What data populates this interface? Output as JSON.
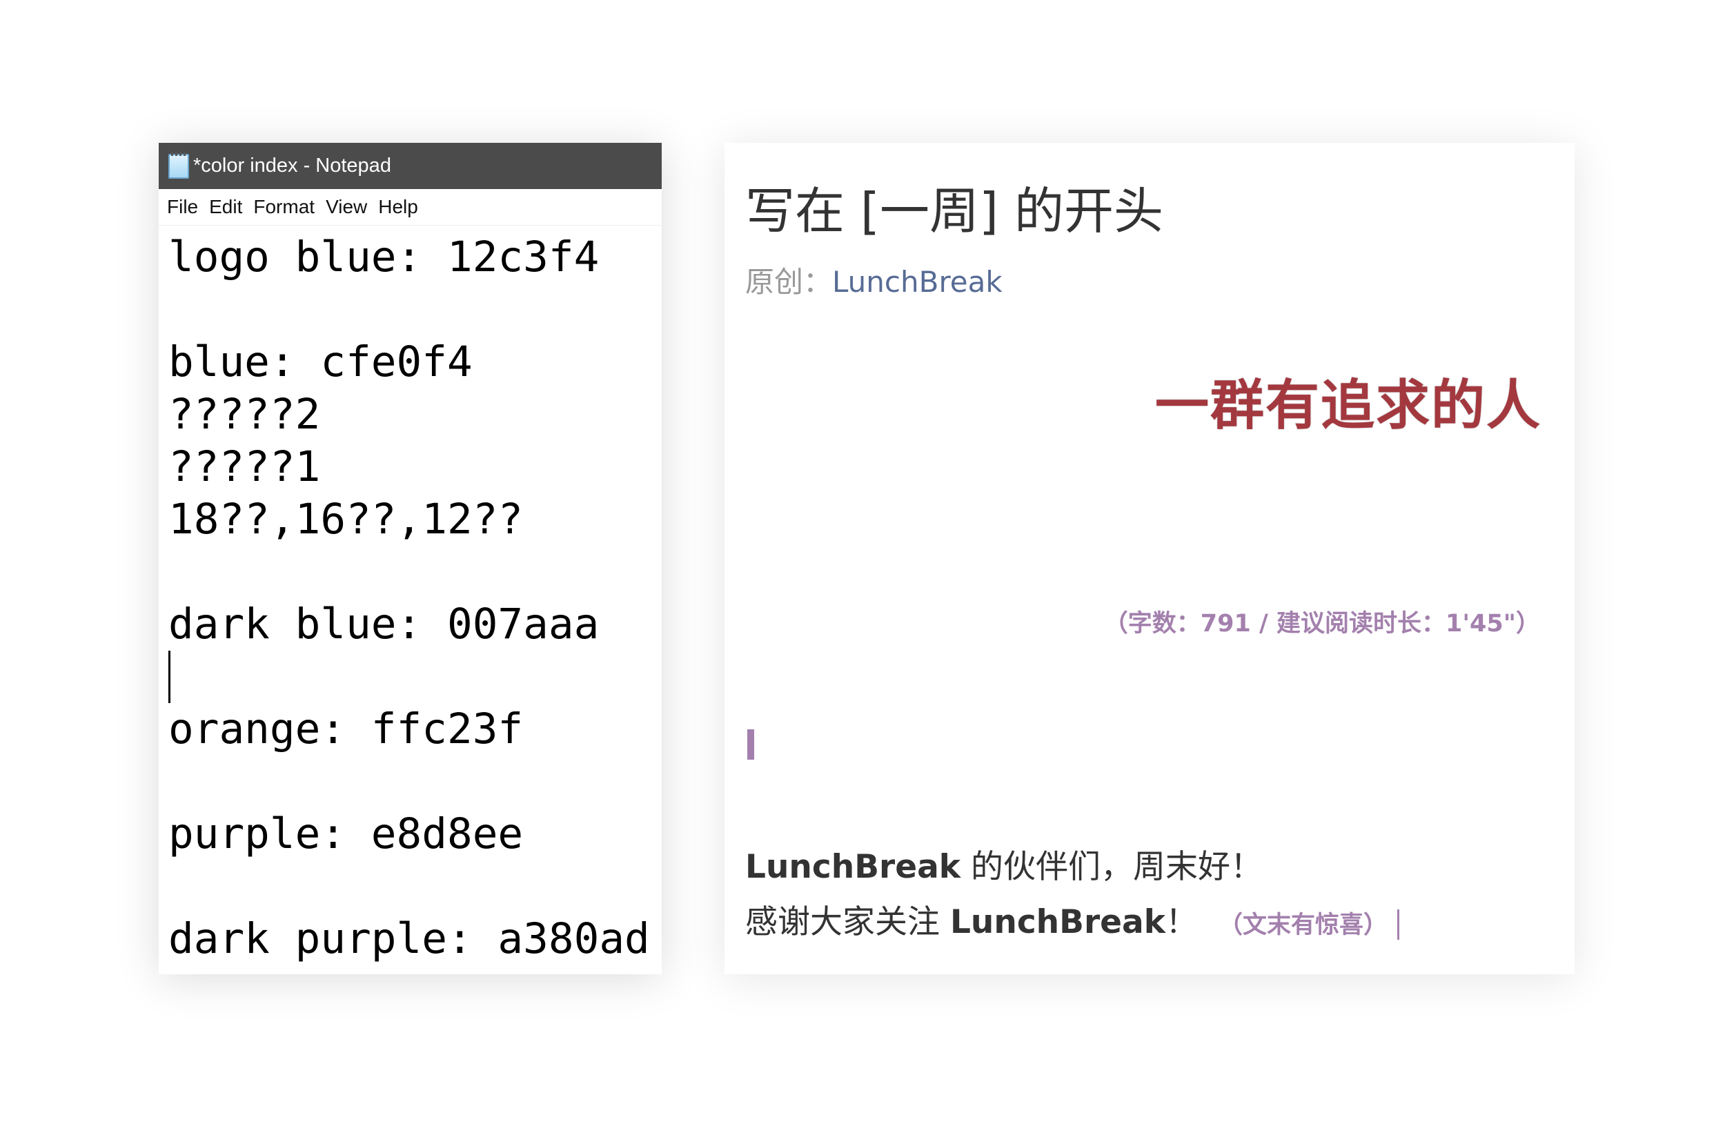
{
  "notepad": {
    "window_title": "*color index - Notepad",
    "menu": [
      "File",
      "Edit",
      "Format",
      "View",
      "Help"
    ],
    "lines": [
      "logo blue: 12c3f4",
      "",
      "blue: cfe0f4",
      "?????2",
      "?????1",
      "18??,16??,12??",
      "",
      "dark blue: 007aaa",
      "",
      "orange: ffc23f",
      "",
      "purple: e8d8ee",
      "",
      "dark purple: a380ad"
    ]
  },
  "article": {
    "title": "写在 [一周] 的开头",
    "byline_prefix": "原创：",
    "author": "LunchBreak",
    "banner_text": "一群有追求的人",
    "word_count": "（字数：791 / 建议阅读时长：1'45\"）",
    "paragraph1_brand": "LunchBreak",
    "paragraph1_text": " 的伙伴们，周末好！",
    "paragraph2_prefix": "感谢大家关注 ",
    "paragraph2_brand": "LunchBreak",
    "paragraph2_suffix": "！",
    "surprise_note": "（文末有惊喜）"
  },
  "colors": {
    "titlebar": "#4b4b4b",
    "accent_purple": "#a380ad",
    "author_link": "#576b95",
    "banner_red": "#a3383f"
  }
}
